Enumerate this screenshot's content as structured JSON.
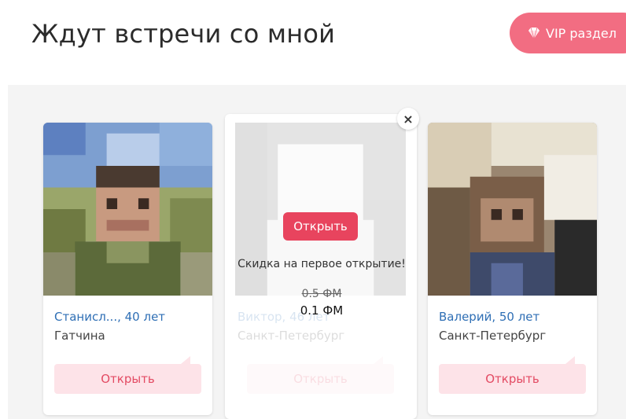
{
  "header": {
    "title": "Ждут встречи со мной",
    "vip_label": "VIP раздел",
    "vip_icon": "diamond-icon"
  },
  "colors": {
    "accent": "#f26d82",
    "open_button_bg": "#fde3e8",
    "open_button_text": "#e34b63",
    "name_link": "#2f6fb5",
    "promo_button": "#e8445e"
  },
  "cards": [
    {
      "name": "Станисл..., 40 лет",
      "city": "Гатчина",
      "button": "Открыть"
    },
    {
      "name": "Виктор, 46 лет",
      "city": "Санкт-Петербург",
      "button": "Открыть"
    },
    {
      "name": "Валерий, 50 лет",
      "city": "Санкт-Петербург",
      "button": "Открыть"
    }
  ],
  "promo": {
    "button": "Открыть",
    "text": "Скидка на первое открытие!",
    "old_price": "0.5 ФМ",
    "new_price": "0.1 ФМ",
    "close": "×"
  }
}
